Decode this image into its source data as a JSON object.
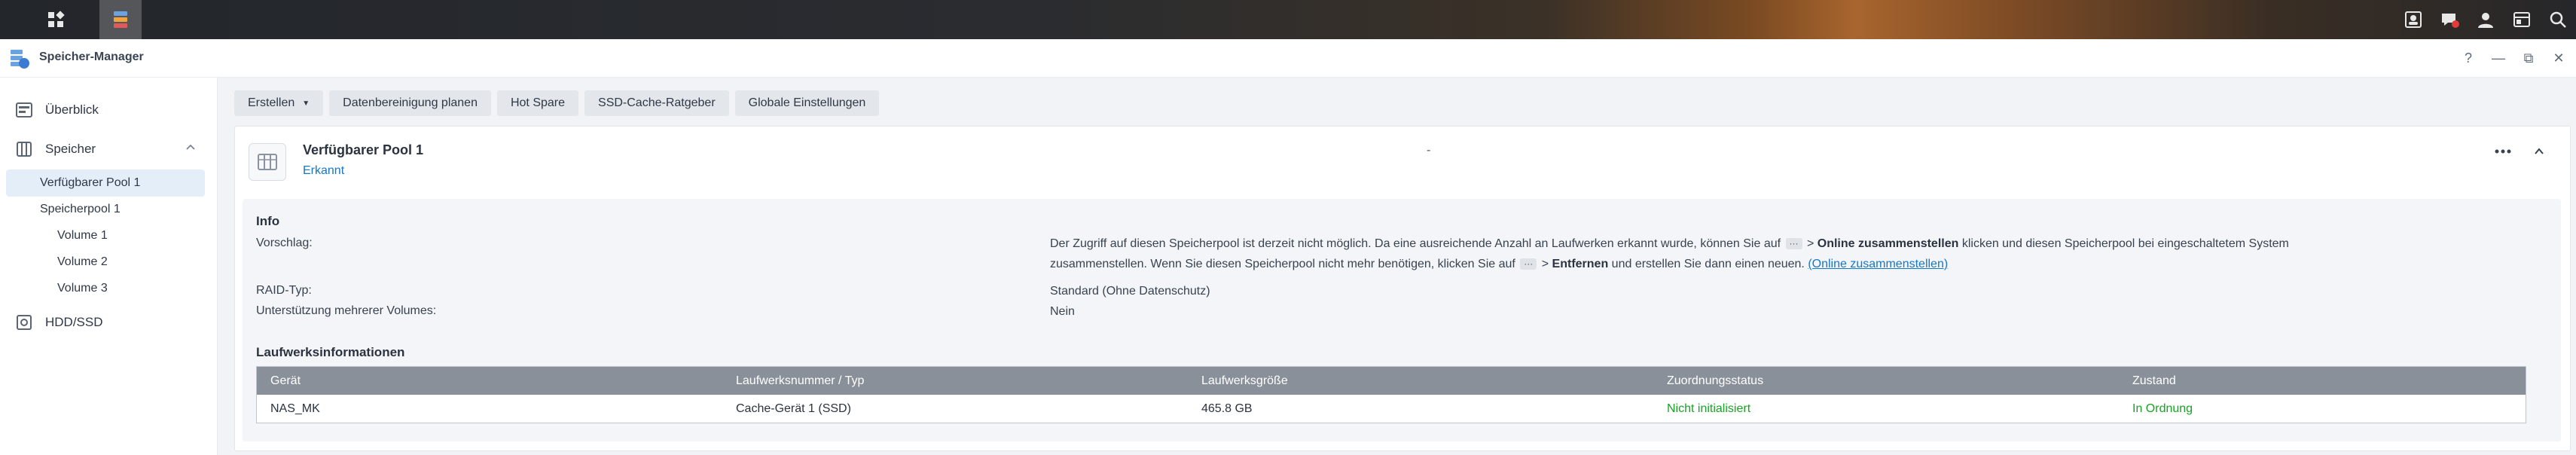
{
  "app": {
    "title": "Speicher-Manager"
  },
  "taskbar": {
    "left_icons": [
      "main-menu-icon",
      "storage-manager-app-icon"
    ],
    "right_icons": [
      "user-badge-icon",
      "notifications-icon",
      "user-icon",
      "widgets-icon",
      "search-icon"
    ]
  },
  "window_controls": [
    "help-icon",
    "minimize-icon",
    "restore-icon",
    "close-icon"
  ],
  "window_control_glyphs": {
    "help": "?",
    "minimize": "—",
    "restore": "⧉",
    "close": "✕"
  },
  "sidebar": {
    "items": [
      {
        "label": "Überblick",
        "icon": "overview-icon"
      },
      {
        "label": "Speicher",
        "icon": "storage-icon"
      },
      {
        "label": "Verfügbarer Pool 1"
      },
      {
        "label": "Speicherpool 1"
      },
      {
        "label": "Volume 1"
      },
      {
        "label": "Volume 2"
      },
      {
        "label": "Volume 3"
      },
      {
        "label": "HDD/SSD",
        "icon": "disk-icon"
      }
    ]
  },
  "toolbar": {
    "create_label": "Erstellen",
    "scrub_label": "Datenbereinigung planen",
    "hotspare_label": "Hot Spare",
    "ssd_cache_label": "SSD-Cache-Ratgeber",
    "global_settings_label": "Globale Einstellungen"
  },
  "pool": {
    "name": "Verfügbarer Pool 1",
    "status": "Erkannt",
    "dash": "-",
    "info": {
      "heading": "Info",
      "suggestion_label": "Vorschlag:",
      "suggestion_line1_a": "Der Zugriff auf diesen Speicherpool ist derzeit nicht möglich. Da eine ausreichende Anzahl an Laufwerken erkannt wurde, können Sie auf",
      "suggestion_line1_b": "> ",
      "suggestion_line1_bold": "Online zusammenstellen",
      "suggestion_line1_c": "klicken und diesen Speicherpool bei eingeschaltetem System",
      "suggestion_line2_a": "zusammenstellen. Wenn Sie diesen Speicherpool nicht mehr benötigen, klicken Sie auf",
      "suggestion_line2_b": "> ",
      "suggestion_line2_bold": "Entfernen",
      "suggestion_line2_c": "und erstellen Sie dann einen neuen.",
      "suggestion_link": "(Online zusammenstellen)",
      "dots": "···",
      "raid_label": "RAID-Typ:",
      "raid_value": "Standard (Ohne Datenschutz)",
      "multi_volume_label": "Unterstützung mehrerer Volumes:",
      "multi_volume_value": "Nein"
    },
    "drives": {
      "heading": "Laufwerksinformationen",
      "columns": [
        "Gerät",
        "Laufwerksnummer / Typ",
        "Laufwerksgröße",
        "Zuordnungsstatus",
        "Zustand"
      ],
      "rows": [
        [
          "NAS_MK",
          "Cache-Gerät 1 (SSD)",
          "465.8 GB",
          "Nicht initialisiert",
          "In Ordnung"
        ]
      ]
    }
  },
  "colors": {
    "accent": "#1677c7",
    "ok_green": "#17a323",
    "selected_bg": "#e3eef9",
    "table_header": "#8a9099"
  }
}
